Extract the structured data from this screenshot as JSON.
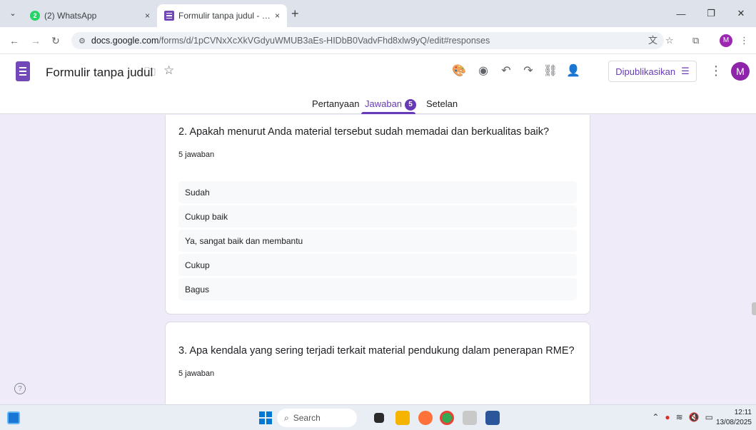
{
  "browser": {
    "tabs": [
      {
        "title": "(2) WhatsApp",
        "badge": "2",
        "close": "×"
      },
      {
        "title": "Formulir tanpa judul - Google F",
        "close": "×"
      }
    ],
    "new_tab": "+",
    "url_host": "docs.google.com",
    "url_path": "/forms/d/1pCVNxXcXkVGdyuWMUB3aEs-HIDbB0VadvFhd8xlw9yQ/edit#responses",
    "profile_initial": "M"
  },
  "forms": {
    "doc_title": "Formulir tanpa judul",
    "publish_label": "Dipublikasikan",
    "avatar_initial": "M",
    "tabs": {
      "questions": "Pertanyaan",
      "responses": "Jawaban",
      "responses_count": "5",
      "settings": "Setelan"
    }
  },
  "questions": [
    {
      "title": "2. Apakah menurut Anda material tersebut sudah memadai dan berkualitas baik?",
      "count": "5 jawaban",
      "answers": [
        "Sudah",
        "Cukup baik",
        "Ya, sangat baik dan membantu",
        "Cukup",
        "Bagus"
      ]
    },
    {
      "title": "3. Apa kendala yang sering terjadi terkait material pendukung dalam penerapan RME?",
      "count": "5 jawaban"
    }
  ],
  "taskbar": {
    "search_label": "Search",
    "time": "12:11",
    "date": "13/08/2025"
  },
  "colors": {
    "forms_purple": "#673ab7",
    "page_bg": "#f0ebf8"
  }
}
